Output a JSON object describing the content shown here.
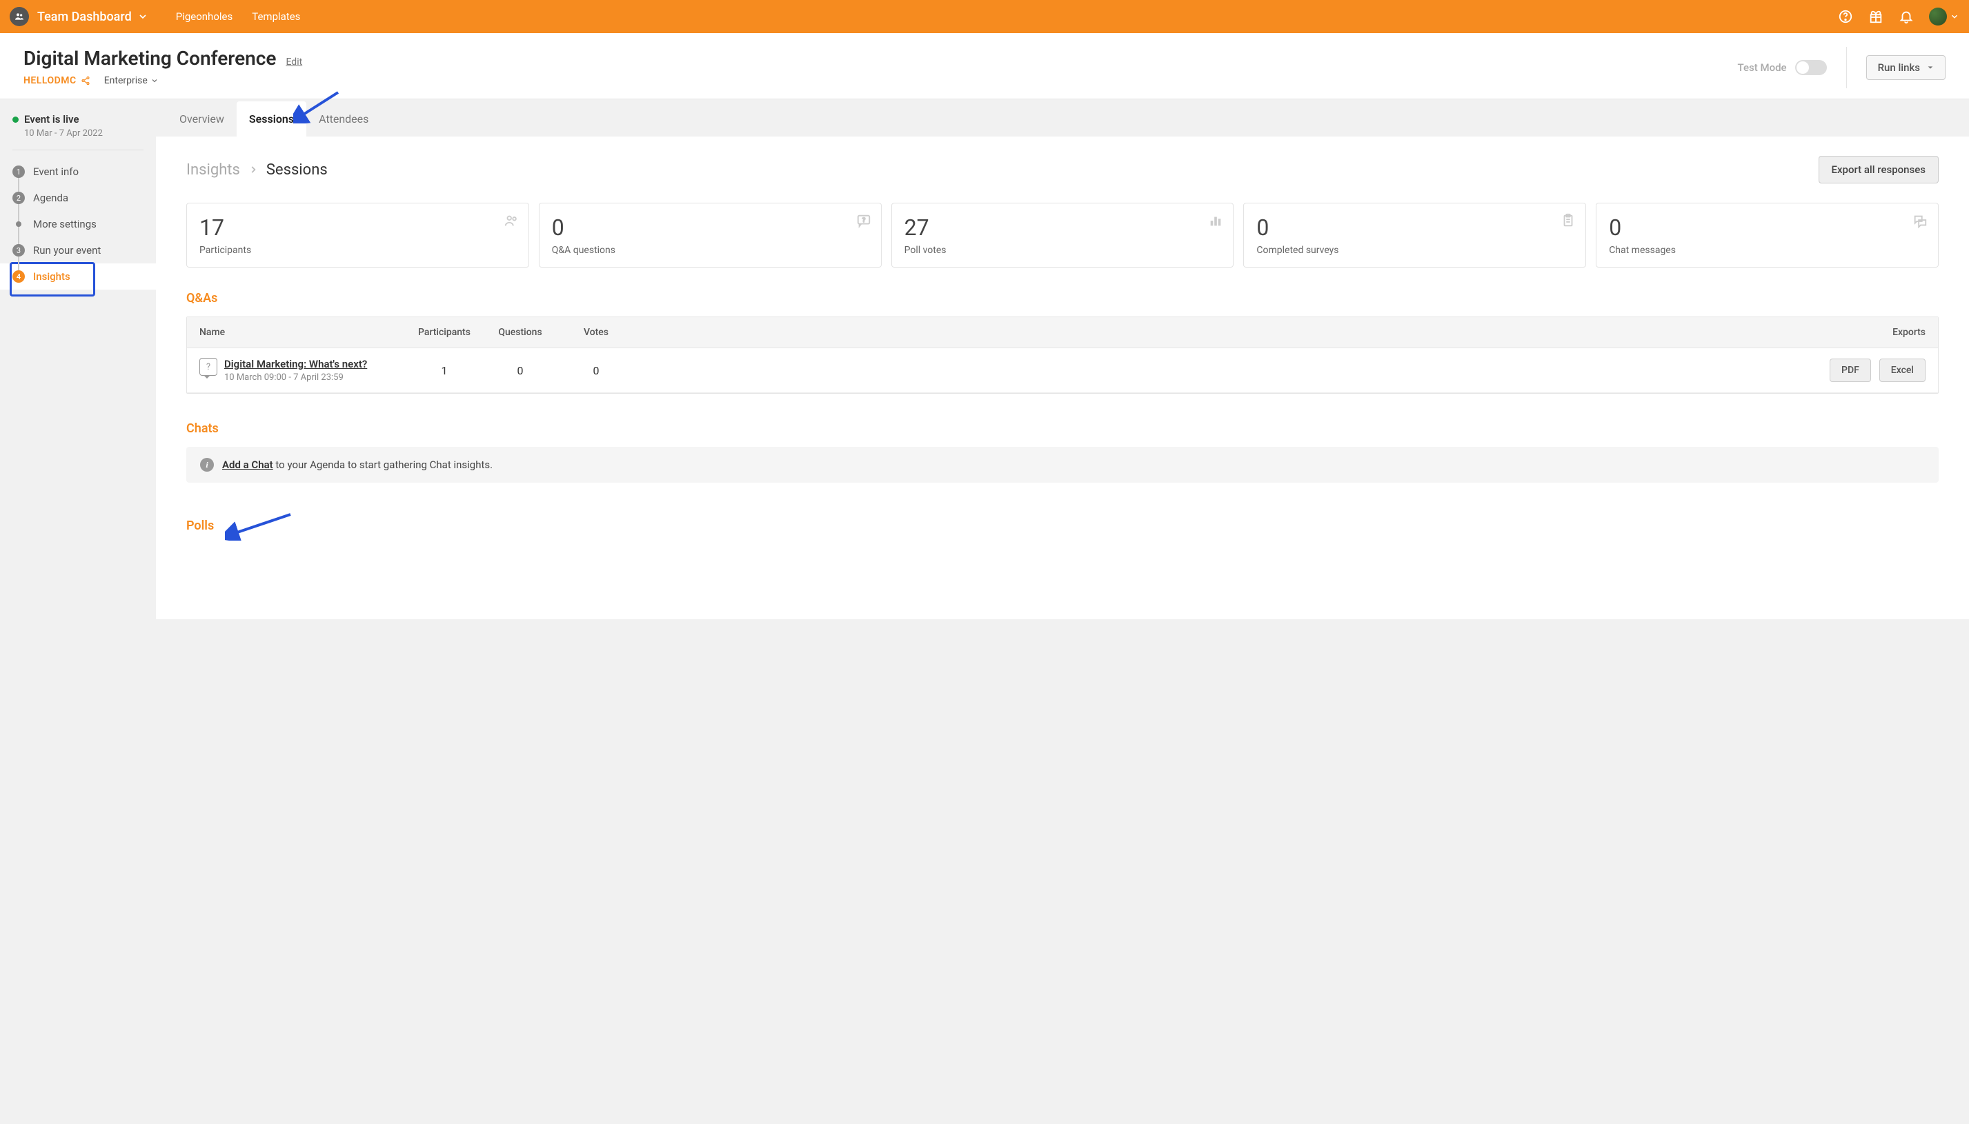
{
  "topbar": {
    "dashboard_label": "Team Dashboard",
    "nav": {
      "pigeonholes": "Pigeonholes",
      "templates": "Templates"
    }
  },
  "event": {
    "title": "Digital Marketing Conference",
    "edit_label": "Edit",
    "code": "HELLODMC",
    "plan": "Enterprise",
    "test_mode_label": "Test Mode",
    "run_links_label": "Run links"
  },
  "sidebar": {
    "live_label": "Event is live",
    "dates": "10 Mar - 7 Apr 2022",
    "steps": {
      "event_info": "Event info",
      "agenda": "Agenda",
      "more_settings": "More settings",
      "run_event": "Run your event",
      "insights": "Insights"
    }
  },
  "tabs": {
    "overview": "Overview",
    "sessions": "Sessions",
    "attendees": "Attendees"
  },
  "breadcrumb": {
    "root": "Insights",
    "leaf": "Sessions"
  },
  "export_all_label": "Export all responses",
  "stats": [
    {
      "value": "17",
      "label": "Participants"
    },
    {
      "value": "0",
      "label": "Q&A questions"
    },
    {
      "value": "27",
      "label": "Poll votes"
    },
    {
      "value": "0",
      "label": "Completed surveys"
    },
    {
      "value": "0",
      "label": "Chat messages"
    }
  ],
  "sections": {
    "qas": "Q&As",
    "chats": "Chats",
    "polls": "Polls"
  },
  "table": {
    "headers": {
      "name": "Name",
      "participants": "Participants",
      "questions": "Questions",
      "votes": "Votes",
      "exports": "Exports"
    },
    "row": {
      "name": "Digital Marketing: What's next?",
      "time": "10 March 09:00 - 7 April 23:59",
      "participants": "1",
      "questions": "0",
      "votes": "0",
      "pdf": "PDF",
      "excel": "Excel"
    }
  },
  "chat_empty": {
    "link": "Add a Chat",
    "rest": " to your Agenda to start gathering Chat insights."
  }
}
